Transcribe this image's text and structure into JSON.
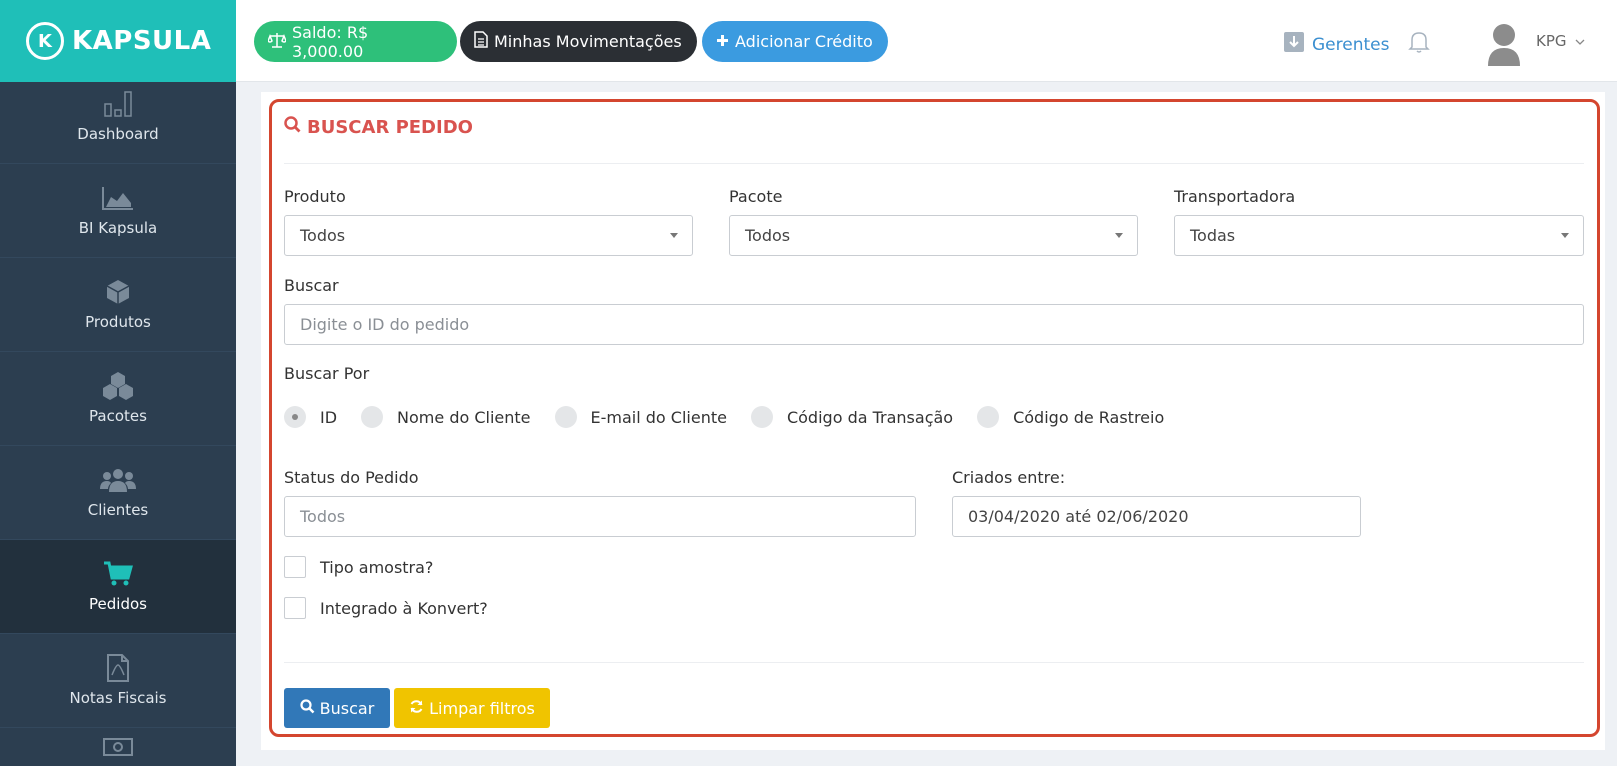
{
  "brand": {
    "name": "KAPSULA",
    "logo_letter": "K"
  },
  "sidebar": {
    "items": [
      {
        "label": "Dashboard",
        "icon": "bar-chart-icon"
      },
      {
        "label": "BI Kapsula",
        "icon": "area-chart-icon"
      },
      {
        "label": "Produtos",
        "icon": "cube-icon"
      },
      {
        "label": "Pacotes",
        "icon": "cubes-icon"
      },
      {
        "label": "Clientes",
        "icon": "users-icon"
      },
      {
        "label": "Pedidos",
        "icon": "shopping-cart-icon",
        "active": true
      },
      {
        "label": "Notas Fiscais",
        "icon": "pdf-file-icon"
      }
    ]
  },
  "header": {
    "saldo": "Saldo: R$ 3,000.00",
    "movimentacoes": "Minhas Movimentações",
    "adicionar": "Adicionar Crédito",
    "gerentes": "Gerentes",
    "user": "KPG"
  },
  "form": {
    "title": "BUSCAR PEDIDO",
    "produto": {
      "label": "Produto",
      "value": "Todos"
    },
    "pacote": {
      "label": "Pacote",
      "value": "Todos"
    },
    "transportadora": {
      "label": "Transportadora",
      "value": "Todas"
    },
    "buscar": {
      "label": "Buscar",
      "placeholder": "Digite o ID do pedido"
    },
    "buscar_por": {
      "label": "Buscar Por",
      "options": [
        "ID",
        "Nome do Cliente",
        "E-mail do Cliente",
        "Código da Transação",
        "Código de Rastreio"
      ],
      "selected": "ID"
    },
    "status": {
      "label": "Status do Pedido",
      "placeholder": "Todos"
    },
    "criados": {
      "label": "Criados entre:",
      "value": "03/04/2020 até 02/06/2020"
    },
    "tipo_amostra": "Tipo amostra?",
    "integrado": "Integrado à Konvert?",
    "btn_buscar": "Buscar",
    "btn_limpar": "Limpar filtros"
  },
  "colors": {
    "teal": "#1fbfb8",
    "sidebar": "#2c3e50",
    "green": "#2ec07a",
    "blue": "#3b9be0",
    "red": "#d9534f",
    "yellow": "#f0c400"
  }
}
